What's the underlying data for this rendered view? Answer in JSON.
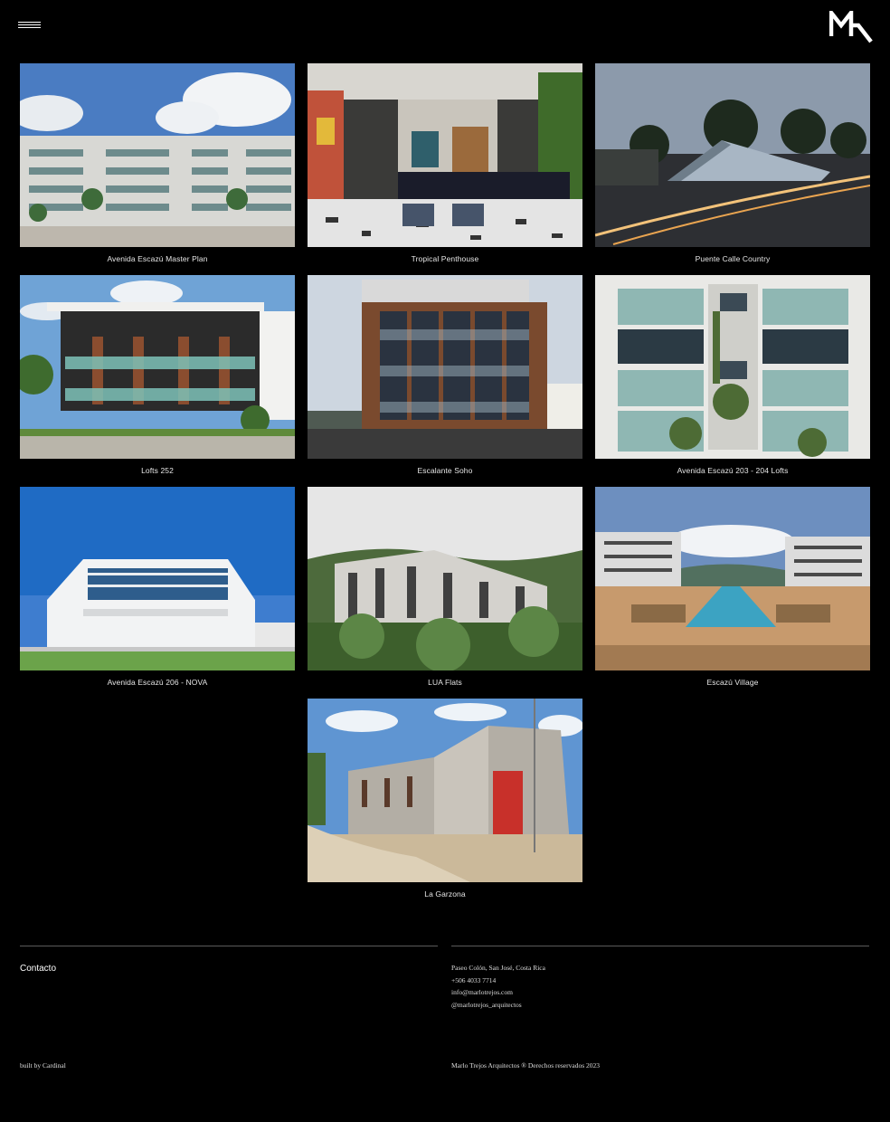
{
  "brand": {
    "logo_alt": "MT"
  },
  "nav": {
    "menu_icon": "hamburger-icon"
  },
  "projects": [
    {
      "title": "Avenida Escazú Master Plan"
    },
    {
      "title": "Tropical Penthouse"
    },
    {
      "title": "Puente Calle Country"
    },
    {
      "title": "Lofts 252"
    },
    {
      "title": "Escalante Soho"
    },
    {
      "title": "Avenida Escazú 203 - 204 Lofts"
    },
    {
      "title": "Avenida Escazú 206 - NOVA"
    },
    {
      "title": "LUA Flats"
    },
    {
      "title": "Escazú Village"
    },
    {
      "title": "La Garzona"
    }
  ],
  "footer": {
    "contact_heading": "Contacto",
    "address": "Paseo Colón, San José, Costa Rica",
    "phone": "+506 4033 7714",
    "email": "info@marlotrejos.com",
    "instagram": "@marlotrejos_arquitectos",
    "built_by": "built by Cardinal",
    "copyright": "Marlo Trejos Arquitectos ® Derechos reservados 2023"
  }
}
